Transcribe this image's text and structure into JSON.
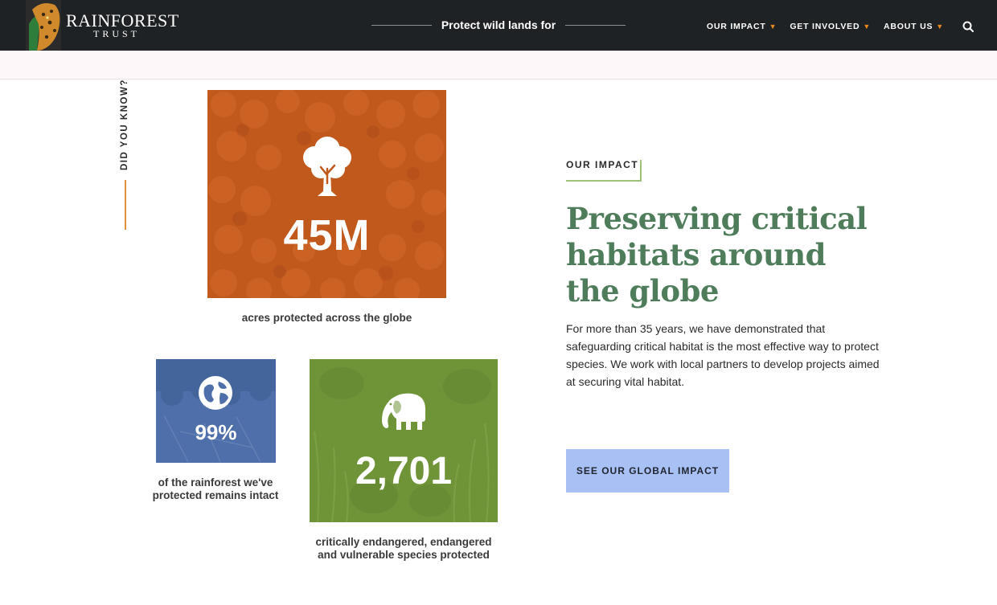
{
  "header": {
    "logo_name": "RAINFOREST",
    "logo_sub": "TRUST",
    "tagline": "Protect wild lands for",
    "nav": [
      {
        "label": "OUR IMPACT"
      },
      {
        "label": "GET INVOLVED"
      },
      {
        "label": "ABOUT US"
      }
    ],
    "search_icon": "search-icon"
  },
  "side": {
    "did_you_know": "DID YOU KNOW?"
  },
  "stats": {
    "acres": {
      "value": "45M",
      "caption": "acres protected across the globe",
      "icon": "tree-icon",
      "color": "#c1581c"
    },
    "rainforest": {
      "value": "99%",
      "caption": "of the rainforest we've protected remains intact",
      "icon": "globe-icon",
      "color": "#4e6fa9"
    },
    "species": {
      "value": "2,701",
      "caption": "critically endangered, endangered and vulnerable species protected",
      "icon": "elephant-icon",
      "color": "#6f9438"
    }
  },
  "impact": {
    "eyebrow": "OUR IMPACT",
    "heading": "Preserving critical habitats around the globe",
    "body": "For more than 35 years, we have demonstrated that safeguarding critical habitat is the most effective way to protect species. We work with local partners to develop projects aimed at securing vital habitat.",
    "cta": "SEE OUR GLOBAL IMPACT"
  },
  "colors": {
    "header_bg": "#1f2224",
    "accent_orange": "#e8891e",
    "heading_green": "#4f7d5b",
    "cta_blue": "#a9c0f4"
  }
}
